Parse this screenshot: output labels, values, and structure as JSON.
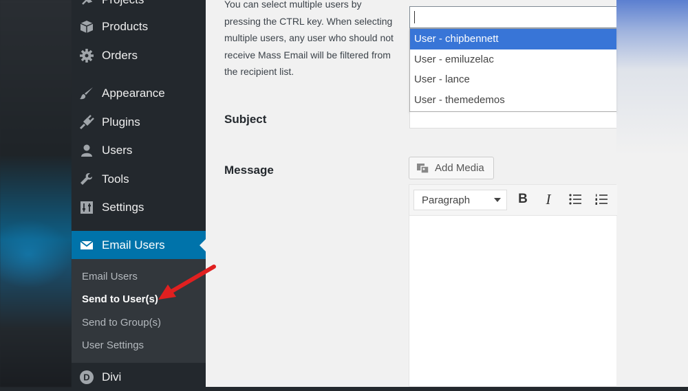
{
  "sidebar": {
    "menu": [
      {
        "label": "Projects",
        "icon": "pin-icon"
      },
      {
        "label": "Products",
        "icon": "box-icon"
      },
      {
        "label": "Orders",
        "icon": "gear-icon"
      },
      {
        "label": "Appearance",
        "icon": "paintbrush-icon"
      },
      {
        "label": "Plugins",
        "icon": "plug-icon"
      },
      {
        "label": "Users",
        "icon": "user-icon"
      },
      {
        "label": "Tools",
        "icon": "wrench-icon"
      },
      {
        "label": "Settings",
        "icon": "sliders-icon"
      },
      {
        "label": "Email Users",
        "icon": "envelope-icon",
        "active": true
      },
      {
        "label": "Divi",
        "icon": "divi-logo-icon"
      }
    ],
    "submenu": [
      {
        "label": "Email Users"
      },
      {
        "label": "Send to User(s)",
        "current": true
      },
      {
        "label": "Send to Group(s)"
      },
      {
        "label": "User Settings"
      }
    ]
  },
  "main": {
    "help_text": "You can select multiple users by pressing the CTRL key. When selecting multiple users, any user who should not receive Mass Email will be filtered from the recipient list.",
    "recipients": {
      "search_value": "",
      "options": [
        {
          "label": "User - chipbennett",
          "highlighted": true
        },
        {
          "label": "User - emiluzelac"
        },
        {
          "label": "User - lance"
        },
        {
          "label": "User - themedemos"
        }
      ]
    },
    "subject_label": "Subject",
    "message_label": "Message",
    "add_media_label": "Add Media",
    "editor": {
      "format_value": "Paragraph",
      "bold_label": "B",
      "italic_label": "I"
    }
  },
  "colors": {
    "sidebar_bg": "#23282d",
    "active_menu": "#0073aa",
    "dropdown_highlight": "#3875d7",
    "annotation_arrow": "#e02020"
  }
}
